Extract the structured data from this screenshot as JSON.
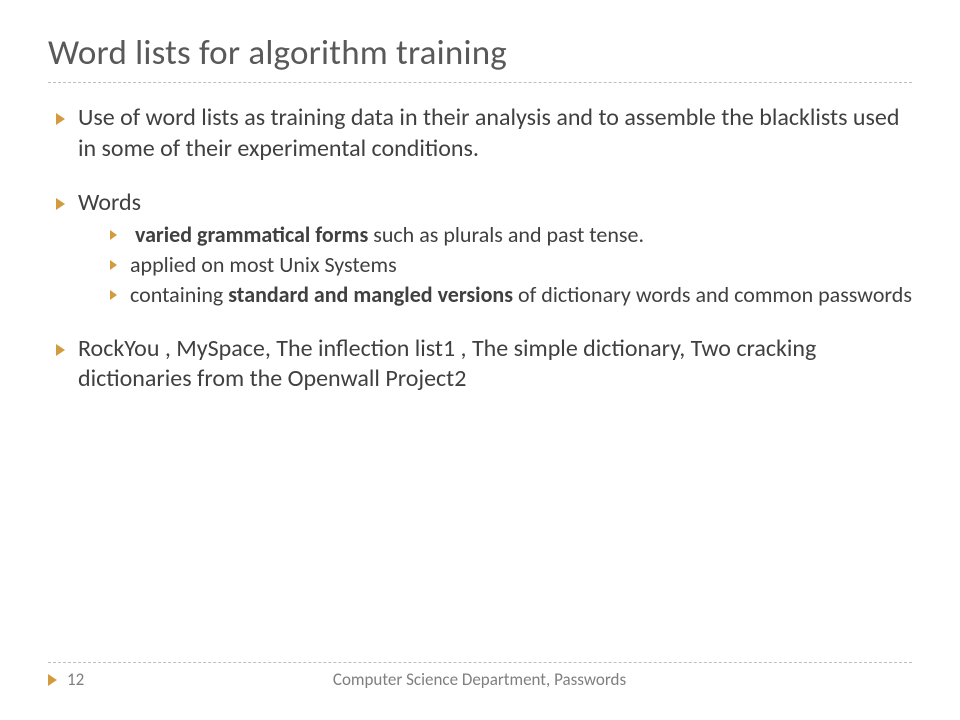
{
  "title": "Word lists for algorithm training",
  "body": {
    "p1": "Use of word lists as training data in their analysis and to assemble the blacklists used in some of their experimental conditions.",
    "p2_label": "Words",
    "p2_sub1_bold": "varied grammatical forms",
    "p2_sub1_rest": " such as plurals and past tense.",
    "p2_sub2": "applied on most Unix Systems",
    "p2_sub3_pre": "containing ",
    "p2_sub3_bold": "standard and mangled versions",
    "p2_sub3_rest": " of dictionary words and common passwords",
    "p3": "RockYou , MySpace, The inflection list1 , The simple dictionary, Two cracking dictionaries from the Openwall Project2"
  },
  "footer": {
    "page": "12",
    "center": "Computer Science Department, Passwords"
  }
}
